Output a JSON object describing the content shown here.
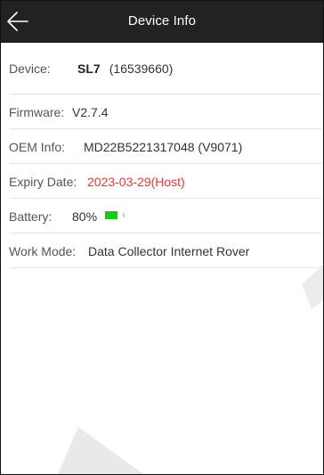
{
  "header": {
    "title": "Device Info",
    "back_icon": "arrow-left-icon"
  },
  "device": {
    "label": "Device:",
    "model": "SL7",
    "serial": "(16539660)"
  },
  "firmware": {
    "label": "Firmware:",
    "value": "V2.7.4"
  },
  "oem": {
    "label": "OEM Info:",
    "value": "MD22B5221317048 (V9071)"
  },
  "expiry": {
    "label": "Expiry Date:",
    "value": "2023-03-29(Host)",
    "color": "#e53935"
  },
  "battery": {
    "label": "Battery:",
    "value": "80%",
    "level": 0.8,
    "color": "#1ec51e"
  },
  "work_mode": {
    "label": "Work Mode:",
    "value": "Data Collector Internet Rover"
  }
}
